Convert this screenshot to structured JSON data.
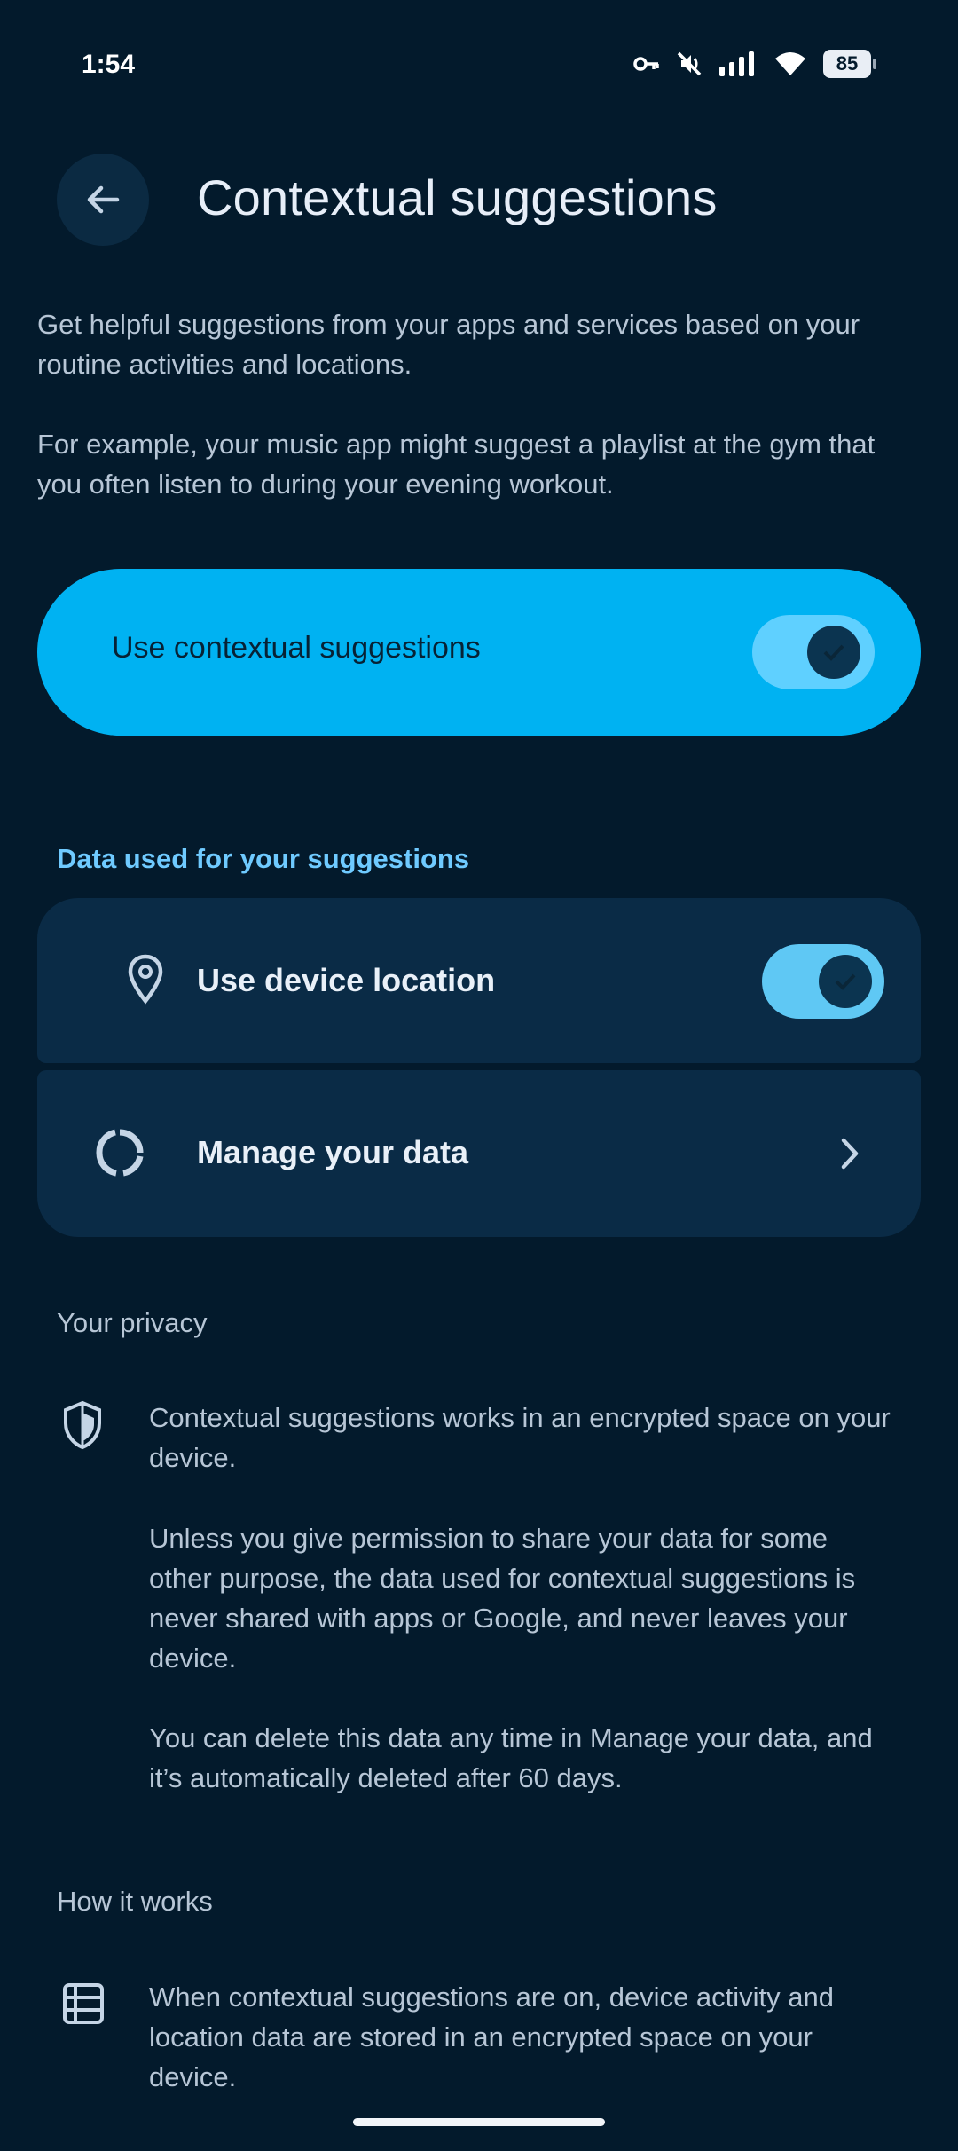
{
  "status_bar": {
    "time": "1:54",
    "battery": "85",
    "icons": [
      "vpn-key-icon",
      "mute-icon",
      "signal-icon",
      "wifi-icon",
      "battery-icon"
    ]
  },
  "header": {
    "back_icon": "arrow-left-icon",
    "title": "Contextual suggestions"
  },
  "intro": {
    "paragraph1": "Get helpful suggestions from your apps and services based on your routine activities and locations.",
    "paragraph2": "For example, your music app might suggest a playlist at the gym that you often listen to during your evening workout."
  },
  "main_toggle": {
    "label": "Use contextual suggestions",
    "on": true
  },
  "data_section": {
    "title": "Data used for your suggestions",
    "items": [
      {
        "label": "Use device location",
        "icon": "location-pin-icon",
        "toggle_on": true
      },
      {
        "label": "Manage your data",
        "icon": "data-circle-icon",
        "chevron": "chevron-right-icon"
      }
    ]
  },
  "privacy_section": {
    "title": "Your privacy",
    "icon": "shield-icon",
    "paragraph1": "Contextual suggestions works in an encrypted space on your device.",
    "paragraph2": "Unless you give permission to share your data for some other purpose, the data used for contextual suggestions is never shared with apps or Google, and never leaves your device.",
    "paragraph3": "You can delete this data any time in Manage your data, and it’s automatically deleted after 60 days."
  },
  "how_section": {
    "title": "How it works",
    "icon": "storage-icon",
    "paragraph1": "When contextual suggestions are on, device activity and location data are stored in an encrypted space on your device."
  },
  "colors": {
    "background": "#031a2c",
    "accent": "#00b2f2",
    "section_title_accent": "#6fcaff",
    "card": "#0a2b46"
  }
}
